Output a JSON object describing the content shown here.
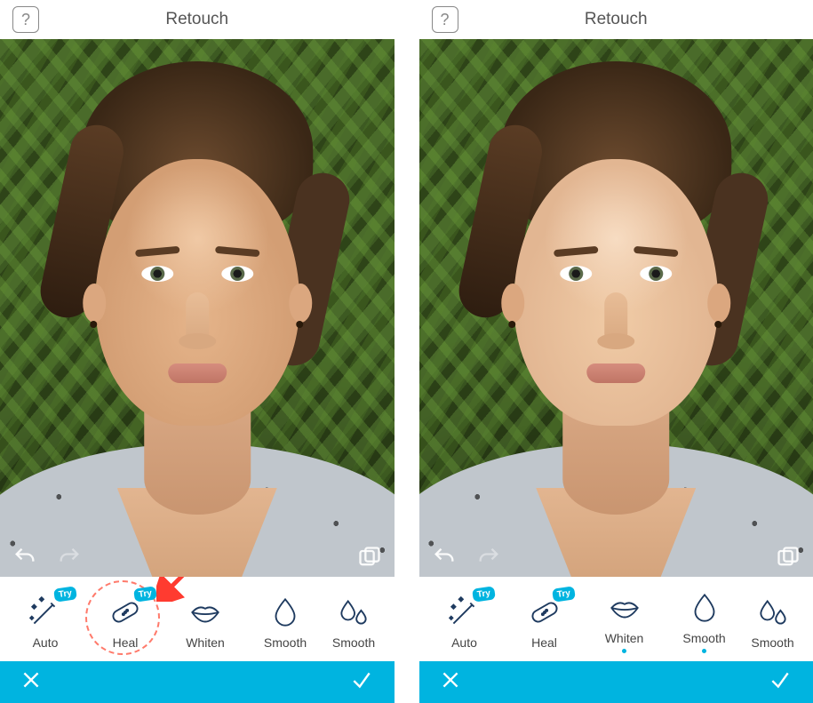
{
  "left": {
    "header": {
      "title": "Retouch",
      "help": "?"
    },
    "tools": [
      {
        "label": "Auto",
        "try": "Try"
      },
      {
        "label": "Heal",
        "try": "Try"
      },
      {
        "label": "Whiten"
      },
      {
        "label": "Smooth"
      },
      {
        "label": "Smooth"
      }
    ],
    "highlight_tool_index": 1
  },
  "right": {
    "header": {
      "title": "Retouch",
      "help": "?"
    },
    "tools": [
      {
        "label": "Auto",
        "try": "Try"
      },
      {
        "label": "Heal",
        "try": "Try"
      },
      {
        "label": "Whiten",
        "active": true
      },
      {
        "label": "Smooth",
        "active": true
      },
      {
        "label": "Smooth"
      }
    ]
  }
}
